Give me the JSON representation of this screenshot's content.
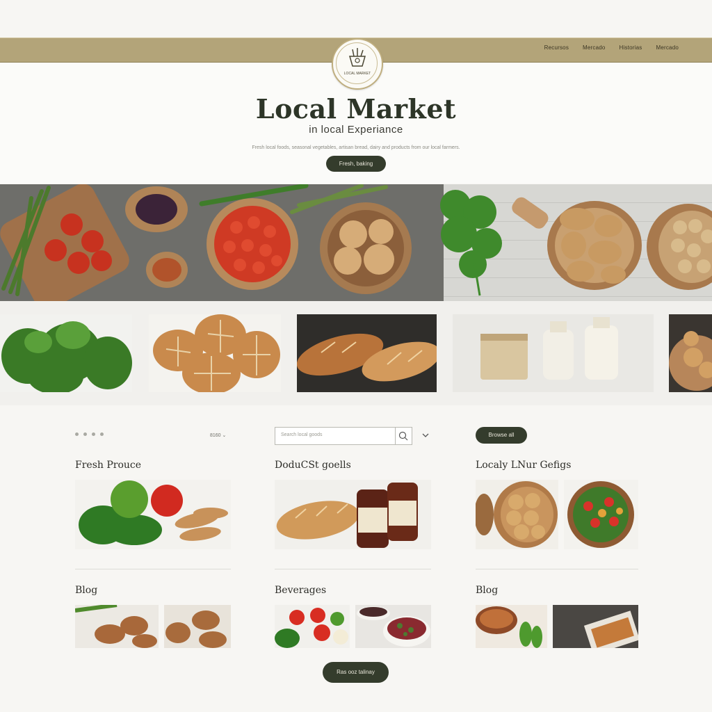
{
  "header": {
    "nav": [
      "Recursos",
      "Mercado",
      "Historias",
      "Mercado"
    ],
    "logo_text": "LOCAL MARKET",
    "title": "Local Market",
    "subtitle": "in local Experiance",
    "tagline": "Fresh local foods, seasonal vegetables, artisan bread, dairy and products from our local farmers.",
    "cta_label": "Fresh, baking"
  },
  "filters": {
    "sort_label": "8160",
    "search_placeholder": "Search local goods",
    "pill_label": "Browse all"
  },
  "sections": [
    {
      "heading": "Fresh Prouce"
    },
    {
      "heading": "DoduCSt goells"
    },
    {
      "heading": "Localy LNur Gefigs"
    },
    {
      "heading": "Blog"
    },
    {
      "heading": "Beverages"
    },
    {
      "heading": "Blog"
    }
  ],
  "footer": {
    "button_label": "Ras ooz talinay"
  },
  "colors": {
    "band": "#b3a479",
    "button": "#343c2c",
    "accent_gold": "#bfae7f"
  }
}
